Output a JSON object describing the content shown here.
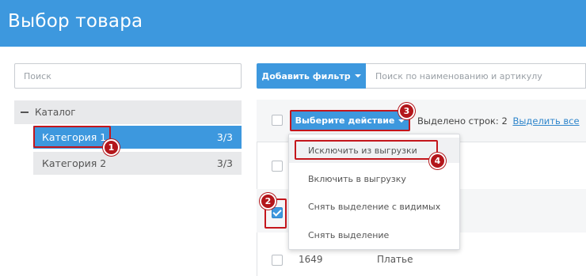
{
  "header": {
    "title": "Выбор товара"
  },
  "left": {
    "search_placeholder": "Поиск",
    "tree": {
      "root_label": "Каталог",
      "items": [
        {
          "label": "Категория 1",
          "count": "3/3"
        },
        {
          "label": "Категория 2",
          "count": "3/3"
        }
      ]
    }
  },
  "right": {
    "filter_button": "Добавить фильтр",
    "search_placeholder": "Поиск по наименованию и артикулу",
    "toolbar": {
      "action_button": "Выберите действие",
      "selected_label": "Выделено строк:",
      "selected_count": "2",
      "select_all": "Выделить все"
    },
    "dropdown": [
      "Исключить из выгрузки",
      "Включить в выгрузку",
      "Снять выделение с видимых",
      "Снять выделение"
    ],
    "rows": [
      {
        "checked": false
      },
      {
        "checked": true
      },
      {
        "checked": false,
        "article": "1649",
        "name": "Платье"
      }
    ]
  },
  "annotations": [
    "1",
    "2",
    "3",
    "4"
  ],
  "colors": {
    "header": "#3d98de",
    "accent": "#3d98de",
    "marker": "#c4161c"
  }
}
